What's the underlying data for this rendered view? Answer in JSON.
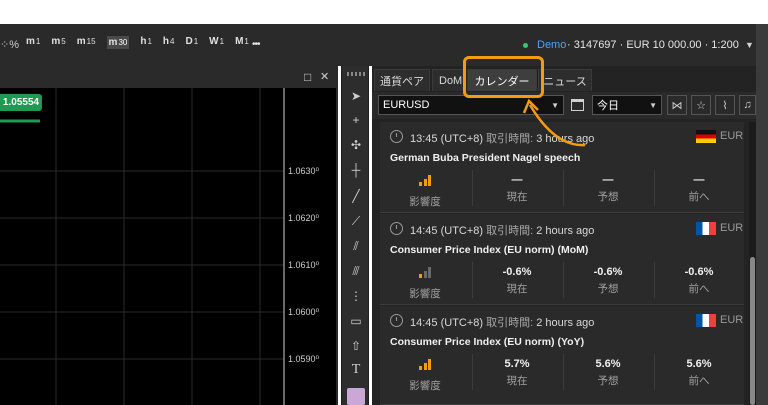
{
  "toolbar": {
    "timeframes": [
      {
        "main": "m",
        "sub": "1"
      },
      {
        "main": "m",
        "sub": "5"
      },
      {
        "main": "m",
        "sub": "15"
      },
      {
        "main": "m",
        "sub": "30"
      },
      {
        "main": "h",
        "sub": "1"
      },
      {
        "main": "h",
        "sub": "4"
      },
      {
        "main": "D",
        "sub": "1"
      },
      {
        "main": "W",
        "sub": "1"
      },
      {
        "main": "M",
        "sub": "1"
      }
    ],
    "more": "•••",
    "account_mode": "Demo",
    "account_info": " · 3147697 · EUR 10 000.00 · 1:200",
    "dropdown_caret": "▼"
  },
  "chart": {
    "price_tag": "1.05554",
    "maximize_icon": "□",
    "close_icon": "✕",
    "y_ticks": [
      "1.0630⁰",
      "1.0620⁰",
      "1.0610⁰",
      "1.0600⁰",
      "1.0590⁰"
    ]
  },
  "calendar": {
    "tabs": [
      "通貨ペア",
      "DoM",
      "カレンダー",
      "ニュース"
    ],
    "active_tab": "カレンダー",
    "symbol": "EURUSD",
    "period": "今日",
    "events": [
      {
        "time": "13:45 (UTC+8)",
        "trade_label": "取引時間:",
        "ago": "3 hours ago",
        "title": "German Buba President Nagel speech",
        "currency": "EUR",
        "flag": "germany",
        "actual": "—",
        "forecast": "—",
        "previous": "—",
        "impact": "medium"
      },
      {
        "time": "14:45 (UTC+8)",
        "trade_label": "取引時間:",
        "ago": "2 hours ago",
        "title": "Consumer Price Index (EU norm) (MoM)",
        "currency": "EUR",
        "flag": "france",
        "actual": "-0.6%",
        "forecast": "-0.6%",
        "previous": "-0.6%",
        "impact": "low"
      },
      {
        "time": "14:45 (UTC+8)",
        "trade_label": "取引時間:",
        "ago": "2 hours ago",
        "title": "Consumer Price Index (EU norm) (YoY)",
        "currency": "EUR",
        "flag": "france",
        "actual": "5.7%",
        "forecast": "5.6%",
        "previous": "5.6%",
        "impact": "medium"
      }
    ],
    "labels": {
      "impact": "影響度",
      "actual": "現在",
      "forecast": "予想",
      "previous": "前へ"
    }
  },
  "colors": {
    "accent": "#f39c12",
    "price_tag": "#1e9a52",
    "demo": "#4aa3ff",
    "impact_on": "#f39c12",
    "impact_off": "#6a6a6a"
  }
}
